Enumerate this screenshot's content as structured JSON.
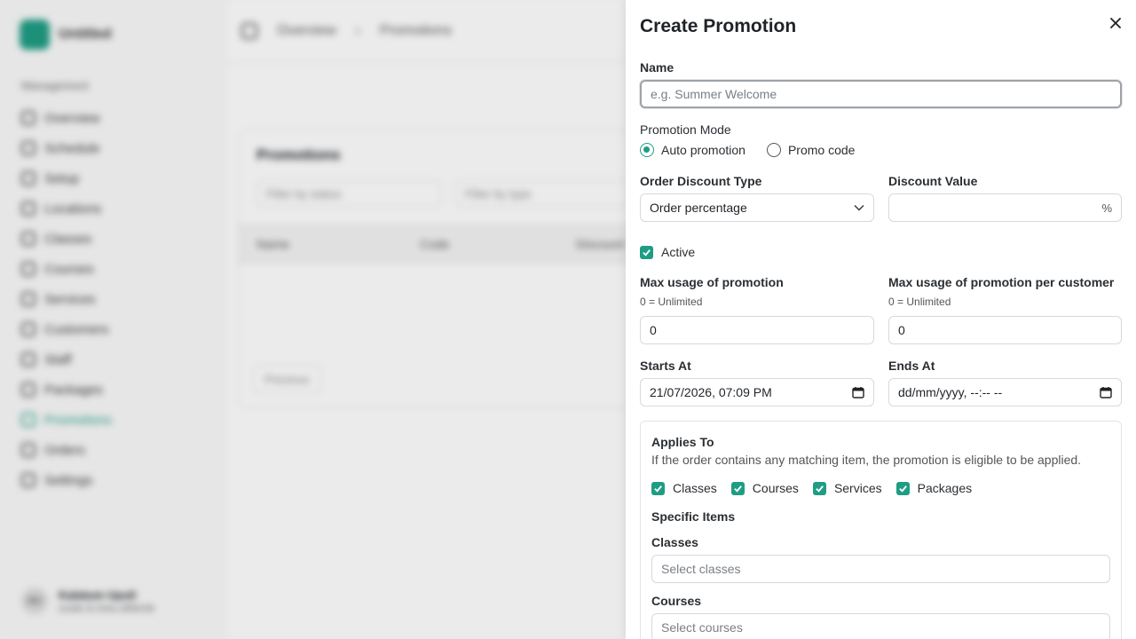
{
  "sidebar": {
    "brand": "Untitled",
    "section": "Management",
    "items": [
      {
        "label": "Overview"
      },
      {
        "label": "Schedule"
      },
      {
        "label": "Setup"
      },
      {
        "label": "Locations"
      },
      {
        "label": "Classes"
      },
      {
        "label": "Courses"
      },
      {
        "label": "Services"
      },
      {
        "label": "Customers"
      },
      {
        "label": "Staff"
      },
      {
        "label": "Packages"
      },
      {
        "label": "Promotions"
      },
      {
        "label": "Orders"
      },
      {
        "label": "Settings"
      }
    ],
    "active_item": "Promotions",
    "user": {
      "initials": "AU",
      "name": "Kalatum Upoli",
      "email": "scale.in.trea.uMemb"
    }
  },
  "topbar": {
    "breadcrumb_1": "Overview",
    "breadcrumb_2": "Promotions"
  },
  "card": {
    "title": "Promotions",
    "filter_status": "Filter by status",
    "filter_type": "Filter by type",
    "columns": [
      "Name",
      "Code",
      "Discount"
    ],
    "prev": "Previous"
  },
  "drawer": {
    "title": "Create Promotion",
    "name": {
      "label": "Name",
      "placeholder": "e.g. Summer Welcome",
      "value": ""
    },
    "mode": {
      "label": "Promotion Mode",
      "options": [
        "Auto promotion",
        "Promo code"
      ],
      "selected": "Auto promotion"
    },
    "discount_type": {
      "label": "Order Discount Type",
      "value": "Order percentage"
    },
    "discount_value": {
      "label": "Discount Value",
      "value": "",
      "unit": "%"
    },
    "active": {
      "label": "Active",
      "checked": true
    },
    "max_usage": {
      "label": "Max usage of promotion",
      "hint": "0 = Unlimited",
      "value": "0"
    },
    "max_usage_customer": {
      "label": "Max usage of promotion per customer",
      "hint": "0 = Unlimited",
      "value": "0"
    },
    "starts_at": {
      "label": "Starts At",
      "value": "21/07/2026, 07:09 PM"
    },
    "ends_at": {
      "label": "Ends At",
      "value": "dd/mm/yyyy, --:-- --"
    },
    "applies_to": {
      "title": "Applies To",
      "description": "If the order contains any matching item, the promotion is eligible to be applied.",
      "types": [
        {
          "label": "Classes",
          "checked": true
        },
        {
          "label": "Courses",
          "checked": true
        },
        {
          "label": "Services",
          "checked": true
        },
        {
          "label": "Packages",
          "checked": true
        }
      ],
      "specific_items_title": "Specific Items",
      "classes": {
        "label": "Classes",
        "placeholder": "Select classes"
      },
      "courses": {
        "label": "Courses",
        "placeholder": "Select courses"
      }
    }
  },
  "colors": {
    "accent": "#1f9d84",
    "border": "#d6d9dd"
  }
}
